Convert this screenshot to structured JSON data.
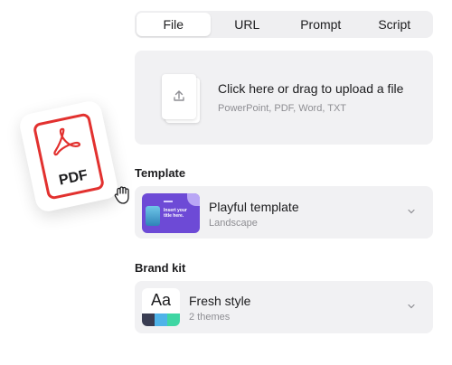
{
  "tabs": [
    {
      "label": "File",
      "active": true
    },
    {
      "label": "URL",
      "active": false
    },
    {
      "label": "Prompt",
      "active": false
    },
    {
      "label": "Script",
      "active": false
    }
  ],
  "upload": {
    "title": "Click here or drag to upload a file",
    "subtitle": "PowerPoint, PDF, Word, TXT",
    "icon": "upload-icon"
  },
  "template_section": {
    "label": "Template",
    "selected": {
      "title": "Playful template",
      "subtitle": "Landscape",
      "thumbnail_text": "Insert your title here."
    }
  },
  "brand_section": {
    "label": "Brand kit",
    "selected": {
      "title": "Fresh style",
      "subtitle": "2 themes",
      "thumbnail_text": "Aa",
      "swatches": [
        "#3a3d52",
        "#4fb3e8",
        "#3fd6a3"
      ]
    }
  },
  "pdf_badge": {
    "label": "PDF",
    "color": "#e2312f"
  },
  "colors": {
    "accent_purple": "#6d4ad6",
    "panel_bg": "#f1f1f3"
  }
}
